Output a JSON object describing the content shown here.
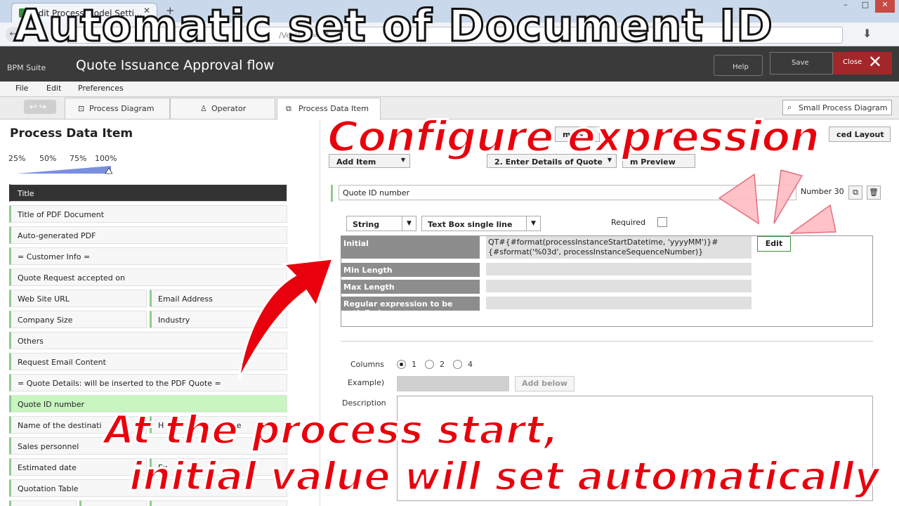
{
  "browser": {
    "tab_title": "Edit Process Model Setti...",
    "tab_close": "✕",
    "new_tab": "+",
    "url": "/Versi...d=10..."
  },
  "app": {
    "logo": "BPM Suite",
    "process_title": "Quote Issuance Approval flow",
    "help_label": "Help",
    "save_label": "Save",
    "close_label": "Close"
  },
  "menu": [
    "File",
    "Edit",
    "Preferences"
  ],
  "tool_tabs": {
    "process_diagram": "Process Diagram",
    "operator": "Operator",
    "process_data_item": "Process Data Item",
    "small_process_diagram": "Small Process Diagram"
  },
  "left": {
    "heading": "Process Data Item",
    "zoom_levels": [
      "25%",
      "50%",
      "75%",
      "100%"
    ],
    "zoom_value": "100%",
    "fields": [
      "Title",
      "Title of PDF Document",
      "Auto-generated PDF",
      "= Customer Info =",
      "Quote Request accepted on",
      "Web Site URL",
      "Email Address",
      "Company Size",
      "Industry",
      "Others",
      "Request Email Content",
      "= Quote Details: will be inserted to the PDF Quote =",
      "Quote ID number",
      "Name of the destinati",
      "H",
      "me",
      "Sales personnel",
      "Estimated date",
      "Ex",
      "e",
      "Quotation Table"
    ]
  },
  "right": {
    "btn_form_list": "m lis",
    "btn_advanced_layout": "ced Layout",
    "add_item": "Add Item",
    "enter_details": "2. Enter Details of Quote",
    "form_preview": "m Preview",
    "item_name": "Quote ID number",
    "number_label": "Number 30",
    "type_select": "String",
    "widget_select": "Text Box single line",
    "required_label": "Required",
    "rows": {
      "initial_label": "Initial",
      "initial_value": "QT#{#format(processInstanceStartDatetime, 'yyyyMM')}#{#sformat('%03d', processInstanceSequenceNumber)}",
      "min_length_label": "Min Length",
      "max_length_label": "Max Length",
      "regex_label": "Regular expression to be satisfied"
    },
    "edit_label": "Edit",
    "columns_label": "Columns",
    "column_options": [
      "1",
      "2",
      "4"
    ],
    "columns_selected": "1",
    "example_label": "Example)",
    "add_below": "Add below",
    "description_label": "Description"
  },
  "annotations": {
    "title": "Automatic set of Document ID",
    "configure": "Configure expression",
    "start_line1": "At the process start,",
    "start_line2": "initial value will set automatically"
  },
  "colors": {
    "annotation_red": "#e8000c",
    "selected_field": "#333333",
    "highlight_field": "#c8f5c0",
    "field_marker": "#8fcb8f",
    "close_button": "#a3262a"
  },
  "icons": {
    "undo": "undo-icon",
    "redo": "redo-icon",
    "copy": "copy-icon",
    "delete": "trash-icon",
    "checkbox": "checkbox-icon"
  }
}
